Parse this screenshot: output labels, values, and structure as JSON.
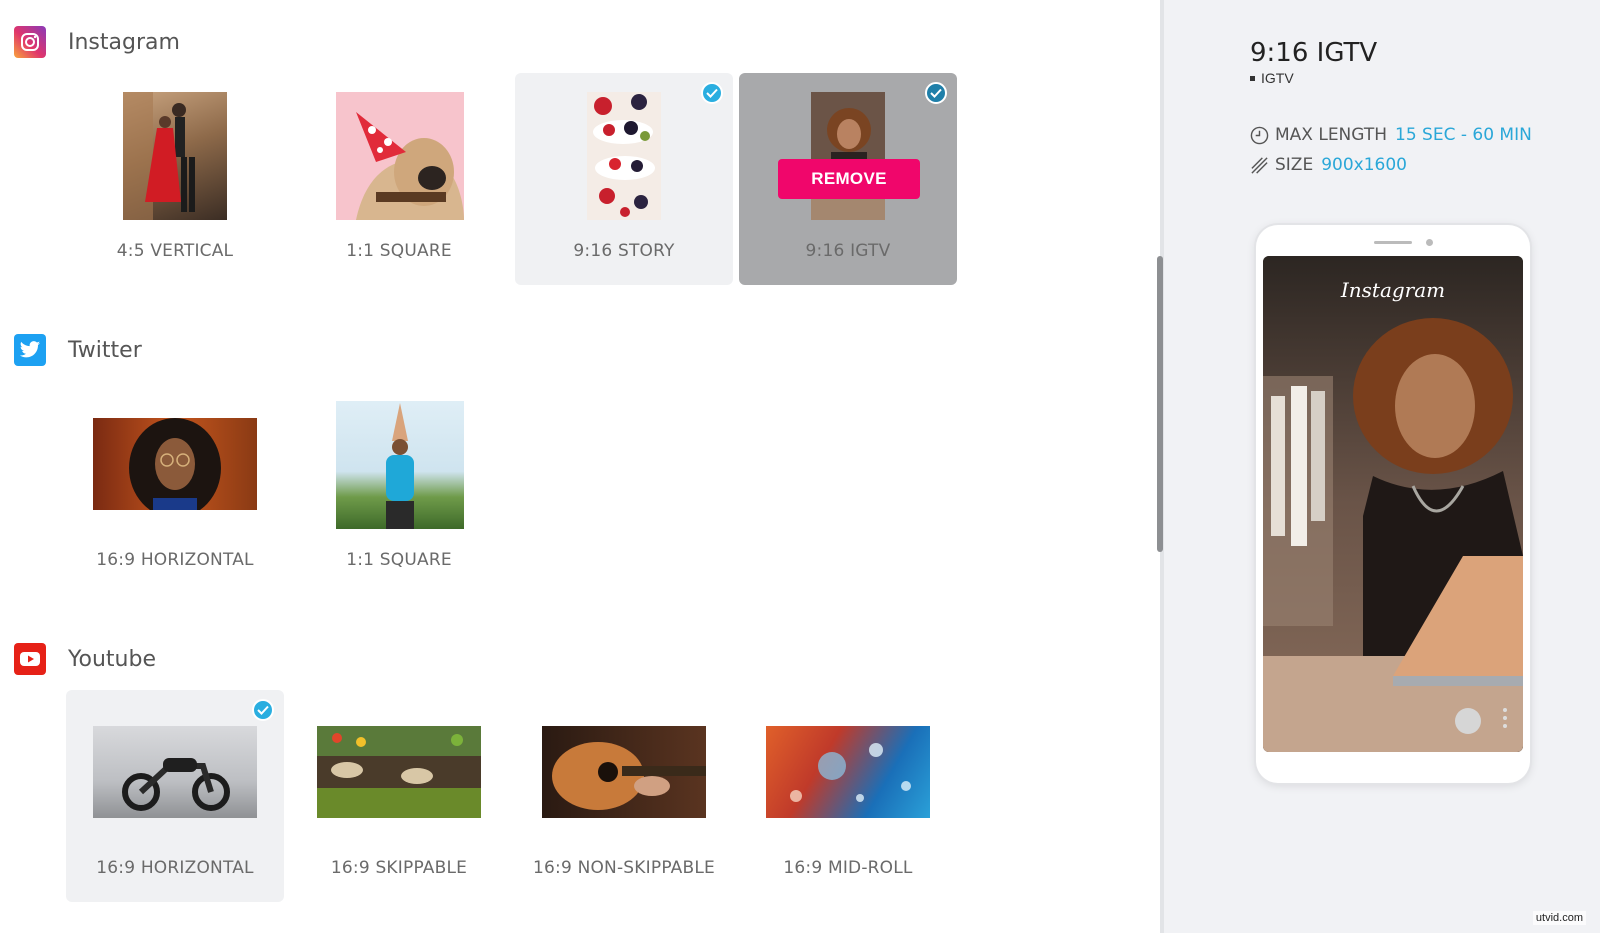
{
  "sections": {
    "instagram": {
      "title": "Instagram",
      "cards": [
        {
          "label": "4:5 VERTICAL",
          "selected": false
        },
        {
          "label": "1:1 SQUARE",
          "selected": false
        },
        {
          "label": "9:16 STORY",
          "selected": true
        },
        {
          "label": "9:16 IGTV",
          "selected": true,
          "active": true,
          "action_label": "REMOVE"
        }
      ]
    },
    "twitter": {
      "title": "Twitter",
      "cards": [
        {
          "label": "16:9 HORIZONTAL",
          "selected": false
        },
        {
          "label": "1:1 SQUARE",
          "selected": false
        }
      ]
    },
    "youtube": {
      "title": "Youtube",
      "cards": [
        {
          "label": "16:9 HORIZONTAL",
          "selected": true
        },
        {
          "label": "16:9 SKIPPABLE",
          "selected": false
        },
        {
          "label": "16:9 NON-SKIPPABLE",
          "selected": false
        },
        {
          "label": "16:9 MID-ROLL",
          "selected": false
        }
      ]
    }
  },
  "preview": {
    "title": "9:16 IGTV",
    "subtitle": "IGTV",
    "max_length_label": "MAX LENGTH",
    "max_length_value": "15 SEC - 60 MIN",
    "size_label": "SIZE",
    "size_value": "900x1600",
    "screen_logo": "Instagram"
  },
  "watermark": "utvid.com",
  "colors": {
    "accent": "#2aa7d8",
    "remove": "#f0066b",
    "instagram": "#d6249f",
    "twitter": "#1da1f2",
    "youtube": "#e62117"
  }
}
